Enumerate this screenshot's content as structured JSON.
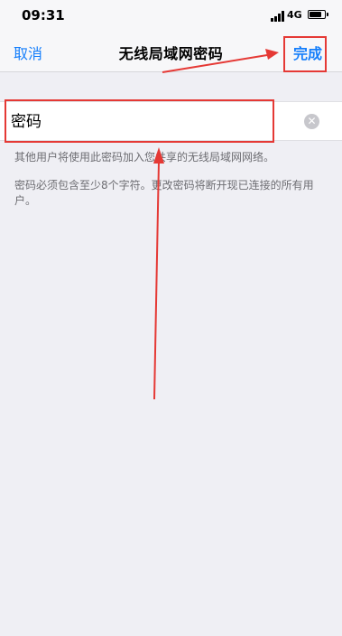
{
  "status_bar": {
    "time": "09:31",
    "network": "4G",
    "battery_level": 0.8,
    "icons": [
      "signal-icon",
      "battery-icon"
    ]
  },
  "nav": {
    "cancel_label": "取消",
    "title": "无线局域网密码",
    "done_label": "完成"
  },
  "password_field": {
    "placeholder": "密码",
    "value": "",
    "clear_icon": "clear-icon"
  },
  "hints": {
    "share_hint": "其他用户将使用此密码加入您共享的无线局域网网络。",
    "rule_hint": "密码必须包含至少8个字符。更改密码将断开现已连接的所有用户。"
  },
  "colors": {
    "accent": "#147efb",
    "annotation": "#e53935",
    "background": "#efeff4"
  }
}
